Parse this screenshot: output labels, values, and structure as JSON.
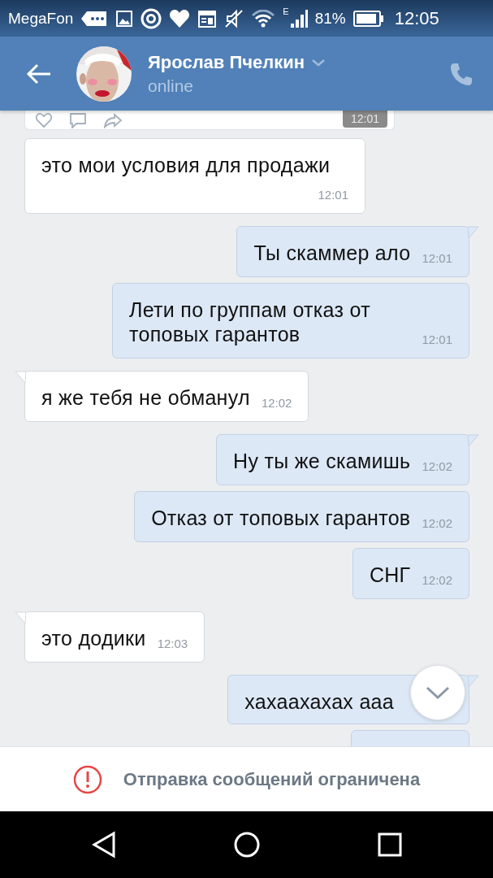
{
  "status_bar": {
    "carrier": "MegaFon",
    "network": "E",
    "battery": "81%",
    "time": "12:05"
  },
  "header": {
    "name": "Ярослав Пчелкин",
    "status": "online"
  },
  "previous_card": {
    "time": "12:01"
  },
  "messages": [
    {
      "text": "это мои условия для продажи",
      "time": "12:01",
      "outgoing": false,
      "tail": false
    },
    {
      "text": "Ты скаммер ало",
      "time": "12:01",
      "outgoing": true,
      "tail": true
    },
    {
      "text": "Лети по группам отказ от топовых гарантов",
      "time": "12:01",
      "outgoing": true,
      "tail": false
    },
    {
      "text": "я же тебя не обманул",
      "time": "12:02",
      "outgoing": false,
      "tail": true
    },
    {
      "text": "Ну ты же скамишь",
      "time": "12:02",
      "outgoing": true,
      "tail": true
    },
    {
      "text": "Отказ от топовых гарантов",
      "time": "12:02",
      "outgoing": true,
      "tail": false
    },
    {
      "text": "СНГ",
      "time": "12:02",
      "outgoing": true,
      "tail": false
    },
    {
      "text": "это додики",
      "time": "12:03",
      "outgoing": false,
      "tail": true
    },
    {
      "text": "хахаахахах ааа",
      "outgoing": true,
      "tail": true
    },
    {
      "outgoing": true,
      "tail": false
    }
  ],
  "notice": {
    "text": "Отправка сообщений ограничена"
  }
}
